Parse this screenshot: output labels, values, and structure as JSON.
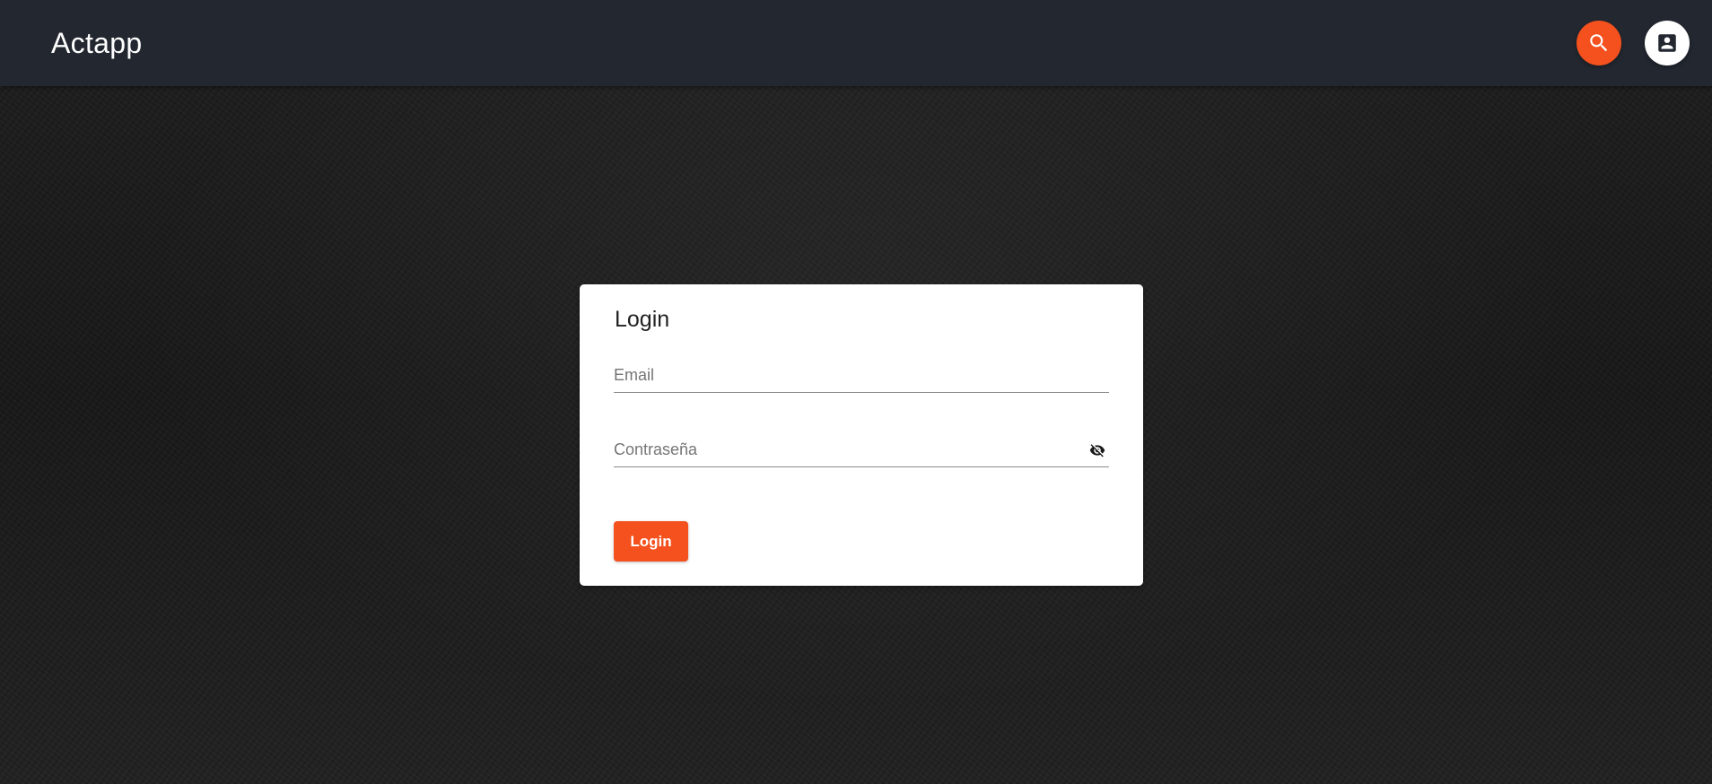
{
  "header": {
    "app_title": "Actapp",
    "search_icon": "search-icon",
    "account_icon": "account-box-icon"
  },
  "login_card": {
    "title": "Login",
    "email": {
      "placeholder": "Email",
      "value": ""
    },
    "password": {
      "placeholder": "Contraseña",
      "value": "",
      "visibility_icon": "eye-off-icon"
    },
    "submit_label": "Login"
  },
  "colors": {
    "accent": "#f4511e",
    "topbar": "#222730",
    "background": "#1c1c1c",
    "card": "#ffffff"
  }
}
